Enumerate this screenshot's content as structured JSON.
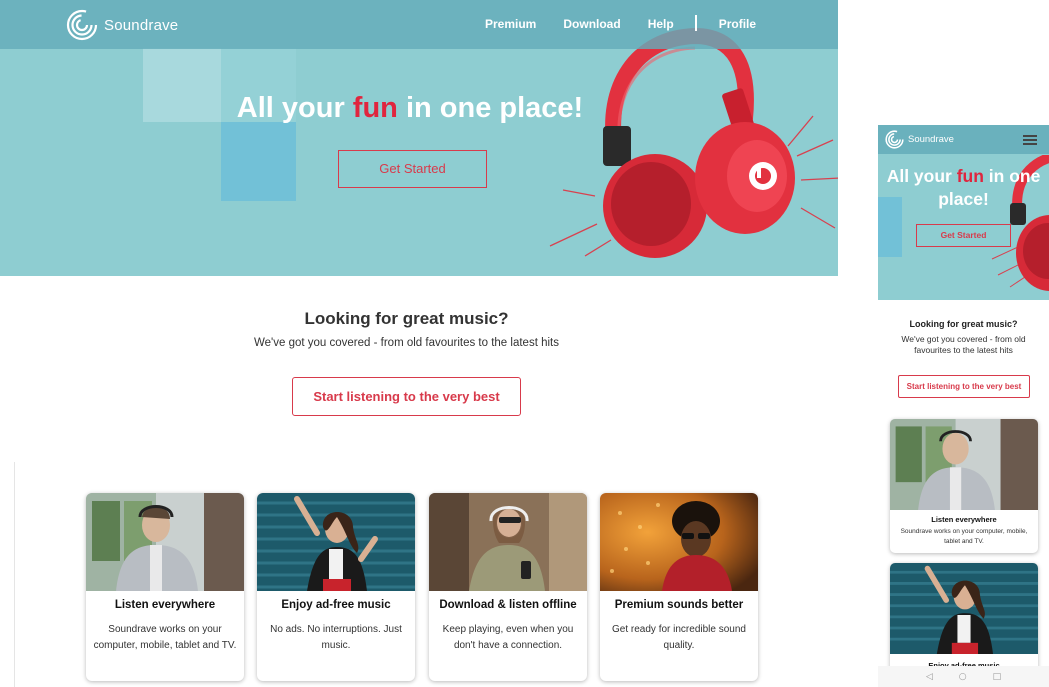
{
  "brand": {
    "name": "Soundrave"
  },
  "nav": {
    "links": [
      "Premium",
      "Download",
      "Help",
      "Profile"
    ]
  },
  "hero": {
    "title_pre": "All your ",
    "title_highlight": "fun",
    "title_post": " in one place!",
    "cta_label": "Get Started"
  },
  "section": {
    "title": "Looking for great music?",
    "subtitle": "We've got you covered - from old favourites to the latest hits",
    "cta_label": "Start listening to the very best"
  },
  "cards": [
    {
      "title": "Listen everywhere",
      "text": "Soundrave works on your computer, mobile, tablet and TV.",
      "image": "man-listening-on-train"
    },
    {
      "title": "Enjoy ad-free music",
      "text": "No ads. No interruptions. Just music.",
      "image": "woman-dancing-headphones"
    },
    {
      "title": "Download & listen offline",
      "text": "Keep playing, even when you don't have a connection.",
      "image": "woman-headphones-phone"
    },
    {
      "title": "Premium sounds better",
      "text": "Get ready for incredible sound quality.",
      "image": "man-glasses-amber"
    }
  ],
  "mobile": {
    "brand_name": "Soundrave",
    "hero_title_pre": "All your ",
    "hero_title_highlight": "fun",
    "hero_title_post": " in one place!",
    "hero_cta": "Get Started",
    "section_title": "Looking for great music?",
    "section_subtitle": "We've got you covered - from old favourites to the latest hits",
    "section_cta": "Start listening to the very best",
    "cards": [
      {
        "title": "Listen everywhere",
        "text": "Soundrave works on your computer, mobile, tablet and TV."
      },
      {
        "title": "Enjoy ad-free music"
      }
    ],
    "bottom_nav_icons": [
      "back-icon",
      "home-icon",
      "recents-icon"
    ]
  },
  "colors": {
    "hero_bg": "#8ecdd1",
    "nav_bg": "#64acba",
    "accent": "#d83a4b",
    "highlight": "#e0253e"
  }
}
